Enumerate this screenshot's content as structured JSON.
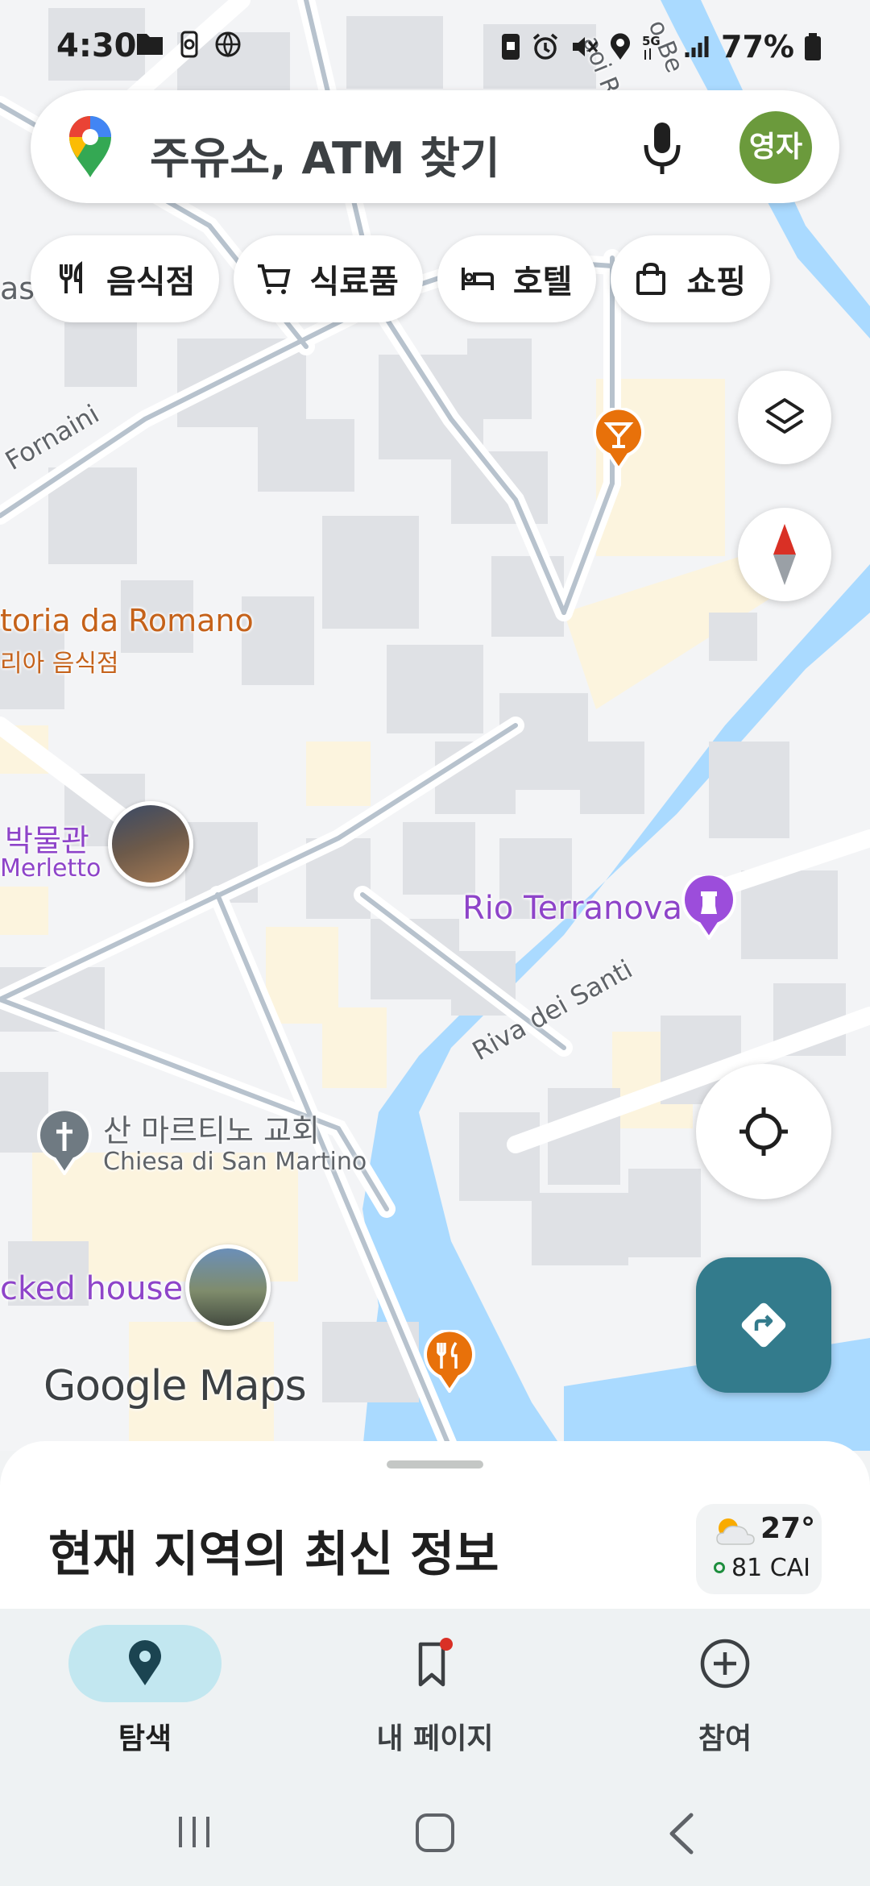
{
  "status_bar": {
    "time": "4:30",
    "battery": "77%",
    "network": "5G"
  },
  "search": {
    "placeholder": "주유소, ATM 찾기",
    "avatar_text": "영자"
  },
  "chips": [
    {
      "label": "음식점",
      "icon": "fork-knife-icon"
    },
    {
      "label": "식료품",
      "icon": "cart-icon"
    },
    {
      "label": "호텔",
      "icon": "bed-icon"
    },
    {
      "label": "쇼핑",
      "icon": "shopping-bag-icon"
    }
  ],
  "map": {
    "labels": {
      "fornaini": "Fornaini",
      "romano_name": "toria da Romano",
      "romano_type": "리아 음식점",
      "museum_ko": "박물관",
      "museum_it": "Merletto",
      "rio_terranova": "Rio Terranova",
      "riva": "Riva dei Santi",
      "church_ko": "산 마르티노 교회",
      "church_it": "Chiesa di San Martino",
      "crooked_house": "cked house",
      "asa": "asa",
      "street_top1": "aoi Ri",
      "street_top2": "o Be"
    },
    "logo": "Google Maps",
    "colors": {
      "water": "#aadaff",
      "roads": "#b7c2cd",
      "blocks": "#dfe1e5",
      "accent_orange": "#e8710a",
      "purple": "#8e44c9"
    }
  },
  "sheet": {
    "title": "현재 지역의 최신 정보",
    "weather": {
      "temp": "27°",
      "aqi": "81 CAI"
    }
  },
  "bottom_nav": [
    {
      "label": "탐색",
      "icon": "location-pin-icon",
      "active": true
    },
    {
      "label": "내 페이지",
      "icon": "bookmark-icon",
      "active": false
    },
    {
      "label": "참여",
      "icon": "add-circle-icon",
      "active": false
    }
  ]
}
